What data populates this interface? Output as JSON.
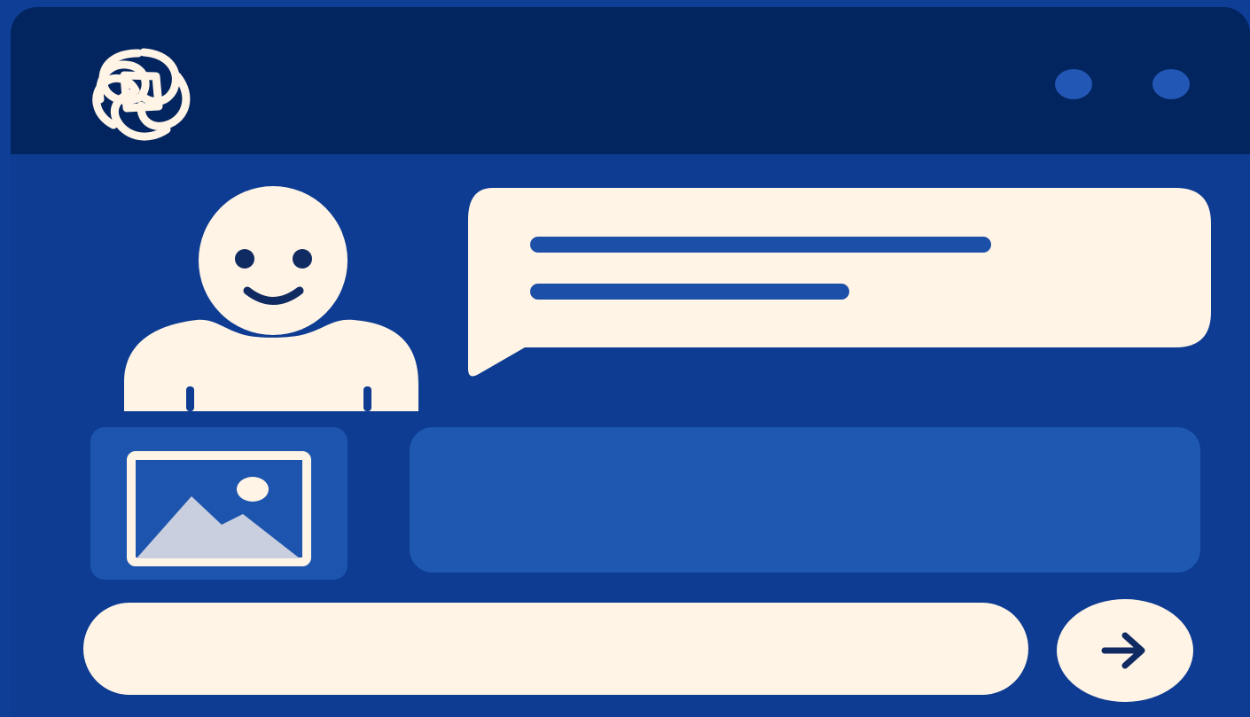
{
  "app": {
    "title": ""
  },
  "header": {
    "logo_icon": "openai-logo-icon",
    "window_controls": [
      "dot-control-icon",
      "dot-control-icon"
    ]
  },
  "chat": {
    "user_avatar_icon": "user-avatar-icon",
    "message_bubble_icon": "chat-bubble-icon",
    "image_attachment_icon": "image-icon"
  },
  "composer": {
    "input_value": "",
    "input_placeholder": "",
    "send_icon": "arrow-right-icon"
  },
  "colors": {
    "page_background": "#0e3e95",
    "titlebar": "#03255f",
    "cream": "#fff4e6",
    "accent_blue": "#1c4fa8",
    "panel_blue": "#1f58b1",
    "dark_navy": "#102a62"
  }
}
